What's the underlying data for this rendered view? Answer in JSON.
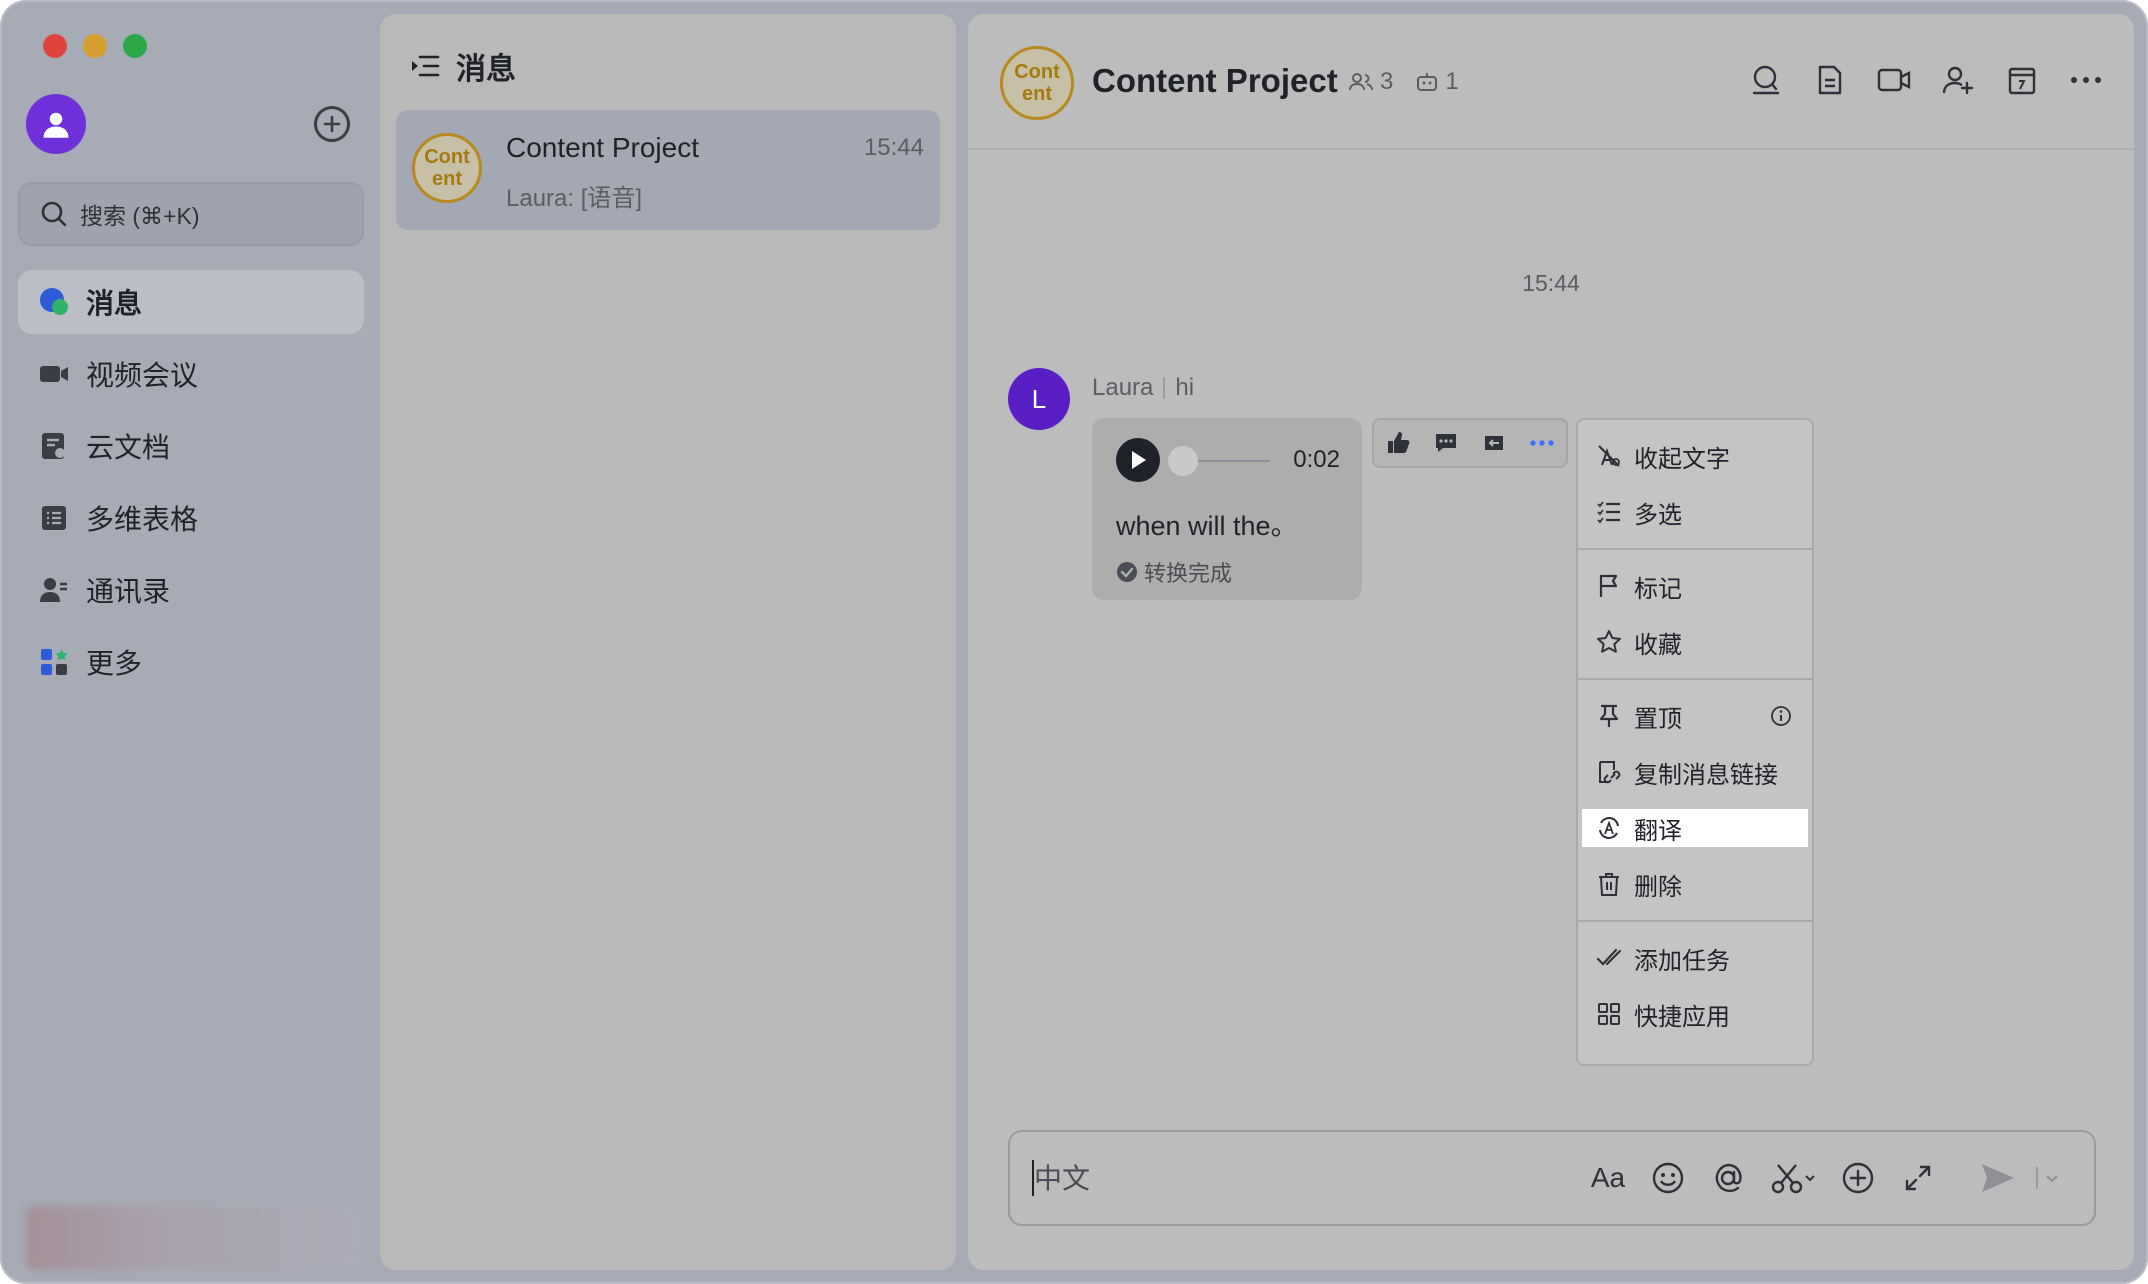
{
  "window": {
    "controls": [
      "close",
      "minimize",
      "maximize"
    ]
  },
  "sidebar": {
    "search": {
      "placeholder": "搜索 (⌘+K)"
    },
    "items": [
      {
        "label": "消息",
        "icon": "message-bubble-icon",
        "active": true
      },
      {
        "label": "视频会议",
        "icon": "video-camera-icon",
        "active": false
      },
      {
        "label": "云文档",
        "icon": "cloud-doc-icon",
        "active": false
      },
      {
        "label": "多维表格",
        "icon": "base-table-icon",
        "active": false
      },
      {
        "label": "通讯录",
        "icon": "contacts-icon",
        "active": false
      },
      {
        "label": "更多",
        "icon": "more-apps-icon",
        "active": false
      }
    ]
  },
  "chat_list": {
    "title": "消息",
    "items": [
      {
        "name": "Content Project",
        "time": "15:44",
        "preview": "Laura: [语音]",
        "logo_text_1": "Cont",
        "logo_text_2": "ent"
      }
    ]
  },
  "conversation": {
    "title": "Content Project",
    "logo_text_1": "Cont",
    "logo_text_2": "ent",
    "member_count": "3",
    "bot_count": "1",
    "time_divider": "15:44",
    "message": {
      "sender_initial": "L",
      "sender": "Laura",
      "reply_to": "hi",
      "duration": "0:02",
      "transcript": "when will the。",
      "status": "转换完成"
    }
  },
  "context_menu": {
    "groups": [
      [
        {
          "label": "收起文字",
          "icon": "hide-text-icon"
        },
        {
          "label": "多选",
          "icon": "multi-select-icon"
        }
      ],
      [
        {
          "label": "标记",
          "icon": "flag-icon"
        },
        {
          "label": "收藏",
          "icon": "star-icon"
        }
      ],
      [
        {
          "label": "置顶",
          "icon": "pin-icon"
        },
        {
          "label": "复制消息链接",
          "icon": "copy-link-icon"
        },
        {
          "label": "翻译",
          "icon": "translate-icon"
        },
        {
          "label": "删除",
          "icon": "trash-icon"
        }
      ],
      [
        {
          "label": "添加任务",
          "icon": "add-task-icon"
        },
        {
          "label": "快捷应用",
          "icon": "apps-grid-icon"
        }
      ]
    ],
    "highlighted": "翻译"
  },
  "composer": {
    "placeholder": "中文",
    "format_label": "Aa"
  },
  "colors": {
    "accent": "#6f2fd9",
    "sender_avatar": "#5a1fc4",
    "group_logo": "#b7891f",
    "active_more": "#3370ff"
  }
}
